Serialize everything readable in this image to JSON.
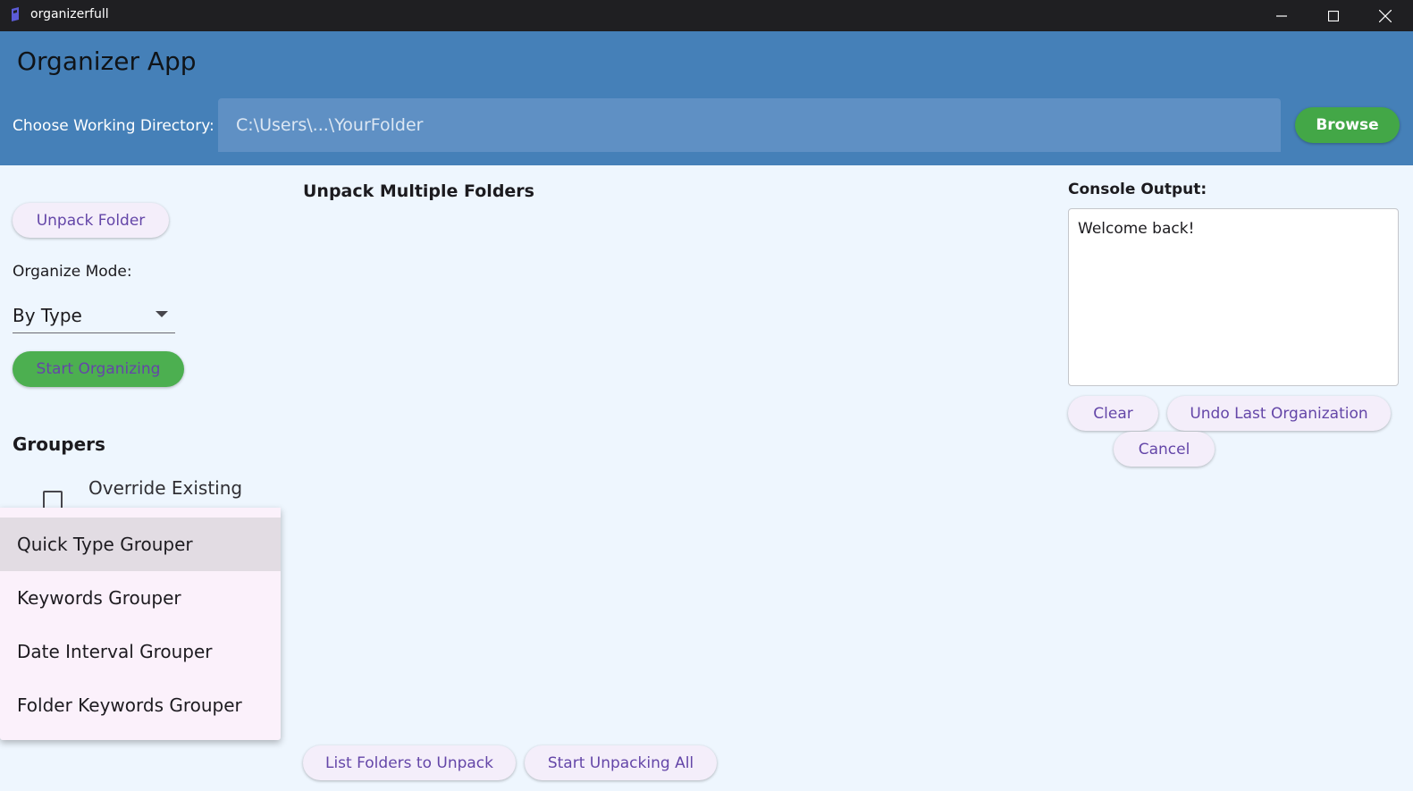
{
  "window": {
    "title": "organizerfull",
    "controls": [
      "minimize-icon",
      "maximize-icon",
      "close-icon"
    ]
  },
  "header": {
    "app_title": "Organizer App",
    "dir_label": "Choose Working Directory:",
    "dir_placeholder": "C:\\Users\\...\\YourFolder",
    "browse_label": "Browse"
  },
  "left_panel": {
    "unpack_folder_label": "Unpack Folder",
    "organize_mode_label": "Organize Mode:",
    "organize_mode_value": "By Type",
    "start_organizing_label": "Start Organizing",
    "groupers_heading": "Groupers",
    "override_label": "Override Existing",
    "override_checked": false
  },
  "grouper_menu": {
    "items": [
      {
        "label": "Quick Type Grouper",
        "highlighted": true
      },
      {
        "label": "Keywords Grouper",
        "highlighted": false
      },
      {
        "label": "Date Interval Grouper",
        "highlighted": false
      },
      {
        "label": "Folder Keywords Grouper",
        "highlighted": false
      }
    ]
  },
  "middle_panel": {
    "heading": "Unpack Multiple Folders",
    "list_folders_label": "List Folders to Unpack",
    "start_unpacking_label": "Start Unpacking All"
  },
  "console": {
    "label": "Console Output:",
    "text": "Welcome back!",
    "clear_label": "Clear",
    "undo_label": "Undo Last Organization",
    "cancel_label": "Cancel"
  },
  "colors": {
    "header_bg": "#4580b8",
    "body_bg": "#eef6fe",
    "accent_green": "#4caf50",
    "button_text": "#6446a8"
  }
}
